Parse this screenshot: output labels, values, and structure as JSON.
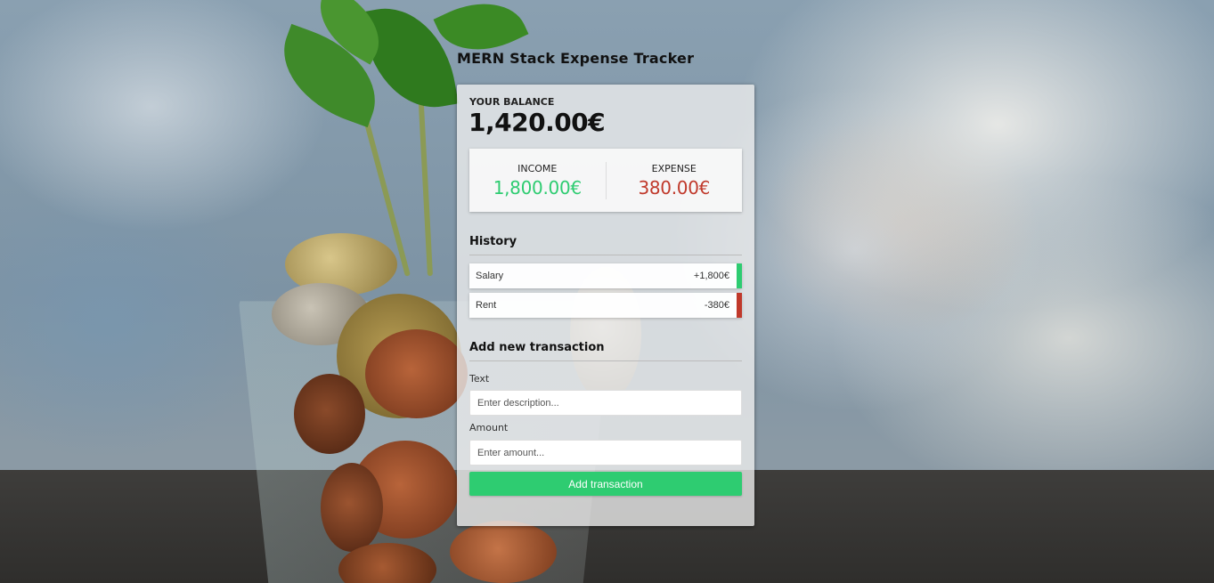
{
  "app": {
    "title": "MERN Stack Expense Tracker"
  },
  "balance": {
    "label": "YOUR BALANCE",
    "value": "1,420.00€"
  },
  "summary": {
    "income_label": "INCOME",
    "income_value": "1,800.00€",
    "expense_label": "EXPENSE",
    "expense_value": "380.00€"
  },
  "history": {
    "title": "History",
    "items": [
      {
        "text": "Salary",
        "amount": "+1,800€",
        "type": "income"
      },
      {
        "text": "Rent",
        "amount": "-380€",
        "type": "expense"
      }
    ]
  },
  "form": {
    "title": "Add new transaction",
    "text_label": "Text",
    "text_placeholder": "Enter description...",
    "amount_label": "Amount",
    "amount_placeholder": "Enter amount...",
    "submit_label": "Add transaction"
  },
  "colors": {
    "income": "#2ecc71",
    "expense": "#c0392b"
  }
}
